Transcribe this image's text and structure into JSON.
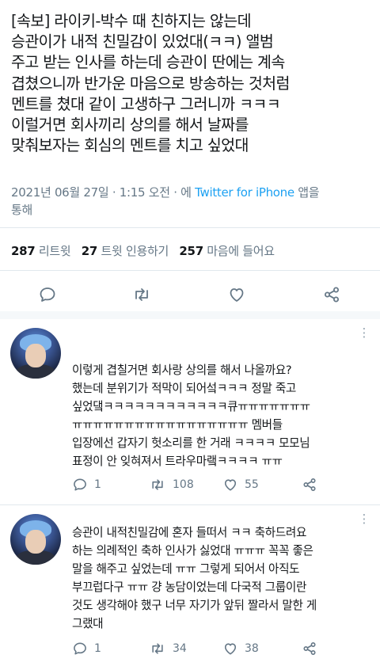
{
  "tweet": {
    "text": "[속보] 라이키-박수 때 친하지는 않는데\n승관이가 내적 친밀감이 있었대(ㅋㅋ) 앨범\n주고 받는 인사를 하는데 승관이 딴에는 계속\n겹쳤으니까 반가운 마음으로 방송하는 것처럼\n멘트를 쳤대 같이 고생하구 그러니까 ㅋㅋㅋ\n이럴거면 회사끼리 상의를 해서 날짜를\n맞춰보자는 회심의 멘트를 치고 싶었대",
    "timestamp": "2021년 06월 27일 · 1:15 오전 · 에 ",
    "source": "Twitter for iPhone",
    "via_suffix": " 앱을",
    "via_suffix2": "통해"
  },
  "stats": {
    "retweets_count": "287",
    "retweets_label": " 리트윗",
    "quotes_count": "27",
    "quotes_label": " 트윗 인용하기",
    "likes_count": "257",
    "likes_label": " 마음에 들어요"
  },
  "replies": [
    {
      "text": "이렇게 겹칠거면 회사랑 상의를 해서 나올까요?\n했는데 분위기가 적막이 되어섴ㅋㅋㅋ 정말 죽고\n싶었댘ㅋㅋㅋㅋㅋㅋㅋㅋㅋㅋㅋㅋ큐ㅠㅠㅠㅠㅠㅠㅠ\nㅠㅠㅠㅠㅠㅠㅠㅠㅠㅠㅠㅠㅠㅠㅠㅠㅠ 멤버들\n입장에선 갑자기 헛소리를 한 거래 ㅋㅋㅋㅋ 모모님\n표정이 안 잊혀져서 트라우마랰ㅋㅋㅋㅋ ㅠㅠ",
      "replies": "1",
      "retweets": "108",
      "likes": "55"
    },
    {
      "text": "승관이 내적친밀감에 혼자 들떠서 ㅋㅋ 축하드려요\n하는 의례적인 축하 인사가 싫었대 ㅠㅠㅠ 꼭꼭 좋은\n말을 해주고 싶었는데 ㅠㅠ 그렇게 되어서 아직도\n부끄럽다구 ㅠㅠ 걍 농담이었는데 다국적 그룹이란\n것도 생각해야 했구 너무 자기가 앞뒤 짤라서 말한 게\n그랬대",
      "replies": "1",
      "retweets": "34",
      "likes": "38"
    }
  ],
  "icons": {
    "reply": "speech-bubble-icon",
    "retweet": "retweet-arrows-icon",
    "like": "heart-icon",
    "share": "share-icon",
    "more": "more-dots-icon"
  },
  "colors": {
    "text": "#14171a",
    "muted": "#657786",
    "link": "#1da1f2",
    "divider": "#e1e8ed"
  }
}
